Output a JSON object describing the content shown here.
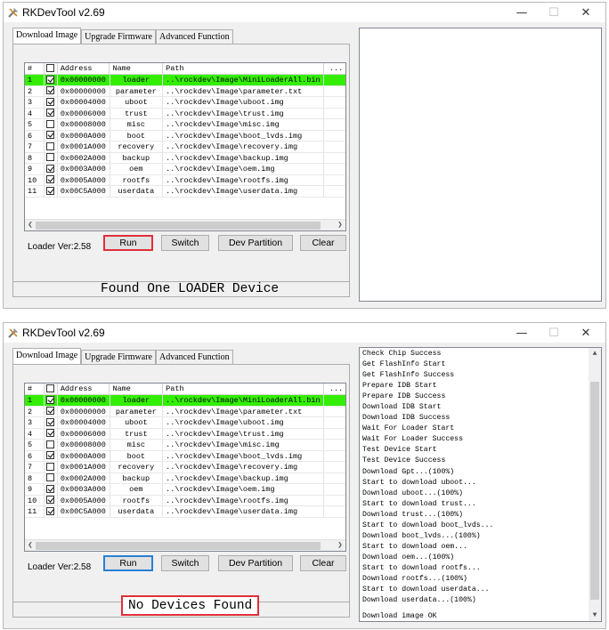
{
  "app": {
    "title": "RKDevTool v2.69",
    "minimize": "—",
    "maximize": "☐",
    "close": "✕"
  },
  "tabs": [
    "Download Image",
    "Upgrade Firmware",
    "Advanced Function"
  ],
  "table": {
    "headers": [
      "#",
      "",
      "Address",
      "Name",
      "Path",
      "..."
    ],
    "rows": [
      {
        "n": "1",
        "checked": true,
        "address": "0x00000000",
        "name": "loader",
        "path": "..\\rockdev\\Image\\MiniLoaderAll.bin"
      },
      {
        "n": "2",
        "checked": true,
        "address": "0x00000000",
        "name": "parameter",
        "path": "..\\rockdev\\Image\\parameter.txt"
      },
      {
        "n": "3",
        "checked": true,
        "address": "0x00004000",
        "name": "uboot",
        "path": "..\\rockdev\\Image\\uboot.img"
      },
      {
        "n": "4",
        "checked": true,
        "address": "0x00006000",
        "name": "trust",
        "path": "..\\rockdev\\Image\\trust.img"
      },
      {
        "n": "5",
        "checked": false,
        "address": "0x00008000",
        "name": "misc",
        "path": "..\\rockdev\\Image\\misc.img"
      },
      {
        "n": "6",
        "checked": true,
        "address": "0x0000A000",
        "name": "boot",
        "path": "..\\rockdev\\Image\\boot_lvds.img"
      },
      {
        "n": "7",
        "checked": false,
        "address": "0x0001A000",
        "name": "recovery",
        "path": "..\\rockdev\\Image\\recovery.img"
      },
      {
        "n": "8",
        "checked": false,
        "address": "0x0002A000",
        "name": "backup",
        "path": "..\\rockdev\\Image\\backup.img"
      },
      {
        "n": "9",
        "checked": true,
        "address": "0x0003A000",
        "name": "oem",
        "path": "..\\rockdev\\Image\\oem.img"
      },
      {
        "n": "10",
        "checked": true,
        "address": "0x0005A000",
        "name": "rootfs",
        "path": "..\\rockdev\\Image\\rootfs.img"
      },
      {
        "n": "11",
        "checked": true,
        "address": "0x00C5A000",
        "name": "userdata",
        "path": "..\\rockdev\\Image\\userdata.img"
      }
    ],
    "selected_row_color": "#33ee00"
  },
  "loader_version": "Loader Ver:2.58",
  "buttons": {
    "run": "Run",
    "switch": "Switch",
    "dev_partition": "Dev Partition",
    "clear": "Clear"
  },
  "window1": {
    "status": "Found One LOADER Device"
  },
  "window2": {
    "status": "No Devices Found",
    "log": [
      " Check Chip Success",
      "Get FlashInfo Start",
      "Get FlashInfo Success",
      "Prepare IDB Start",
      "Prepare IDB Success",
      "Download IDB Start",
      "Download IDB Success",
      "Wait For Loader Start",
      "Wait For Loader Success",
      "Test Device Start",
      "Test Device Success",
      "Download Gpt...(100%)",
      "Start to download uboot...",
      "Download uboot...(100%)",
      "Start to download trust...",
      "Download trust...(100%)",
      "Start to download boot_lvds...",
      "Download boot_lvds...(100%)",
      "Start to download oem...",
      "Download oem...(100%)",
      "Start to download rootfs...",
      "Download rootfs...(100%)",
      "Start to download userdata...",
      "Download userdata...(100%)",
      "Download image OK"
    ]
  },
  "colors": {
    "highlight_red": "#e0303a",
    "focus_blue": "#2a7fd4"
  }
}
